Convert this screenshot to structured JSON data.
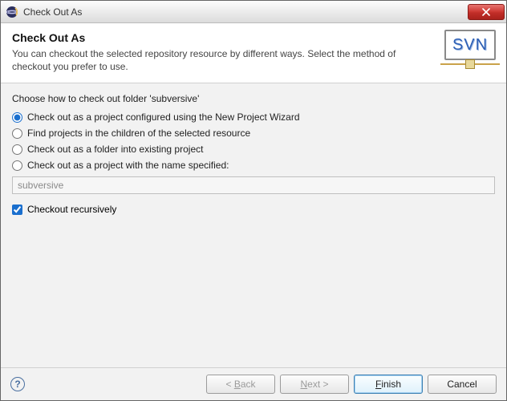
{
  "window": {
    "title": "Check Out As"
  },
  "banner": {
    "heading": "Check Out As",
    "description": "You can checkout the selected repository resource by different ways. Select the method of checkout you prefer to use.",
    "badge_text": "SVN"
  },
  "form": {
    "prompt": "Choose how to check out folder 'subversive'",
    "options": {
      "opt1": "Check out as a project configured using the New Project Wizard",
      "opt2": "Find projects in the children of the selected resource",
      "opt3": "Check out as a folder into existing project",
      "opt4": "Check out as a project with the name specified:"
    },
    "selected_option": "opt1",
    "name_value": "subversive",
    "checkbox_label": "Checkout recursively",
    "checkbox_checked": true
  },
  "buttons": {
    "back": "< Back",
    "next": "Next >",
    "finish": "Finish",
    "cancel": "Cancel"
  }
}
